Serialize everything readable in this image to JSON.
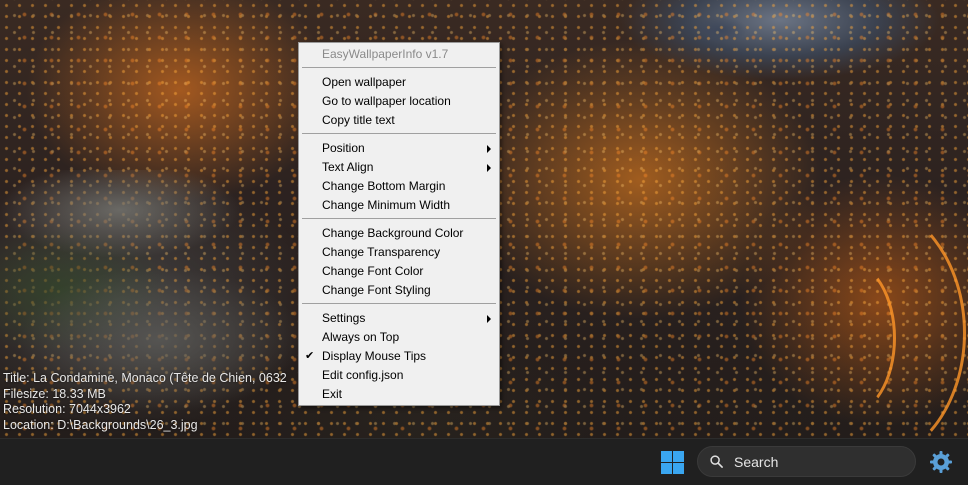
{
  "overlay": {
    "title": "Title: La Condamine, Monaco (Tête de Chien, 0632",
    "filesize": "Filesize: 18.33 MB",
    "resolution": "Resolution: 7044x3962",
    "location": "Location: D:\\Backgrounds\\26_3.jpg"
  },
  "menu": {
    "header": "EasyWallpaperInfo v1.7",
    "open_wallpaper": "Open wallpaper",
    "go_to_location": "Go to wallpaper location",
    "copy_title": "Copy title text",
    "position": "Position",
    "text_align": "Text Align",
    "change_bottom_margin": "Change Bottom Margin",
    "change_minimum_width": "Change Minimum Width",
    "change_background_color": "Change Background Color",
    "change_transparency": "Change Transparency",
    "change_font_color": "Change Font Color",
    "change_font_styling": "Change Font Styling",
    "settings": "Settings",
    "always_on_top": "Always on Top",
    "display_mouse_tips": "Display Mouse Tips",
    "display_mouse_tips_checked": true,
    "edit_config": "Edit config.json",
    "exit": "Exit"
  },
  "taskbar": {
    "search_label": "Search",
    "start_icon": "windows-logo-icon",
    "search_icon": "search-icon",
    "tray_icon": "gear-icon",
    "accent": "#3aa6f0"
  }
}
